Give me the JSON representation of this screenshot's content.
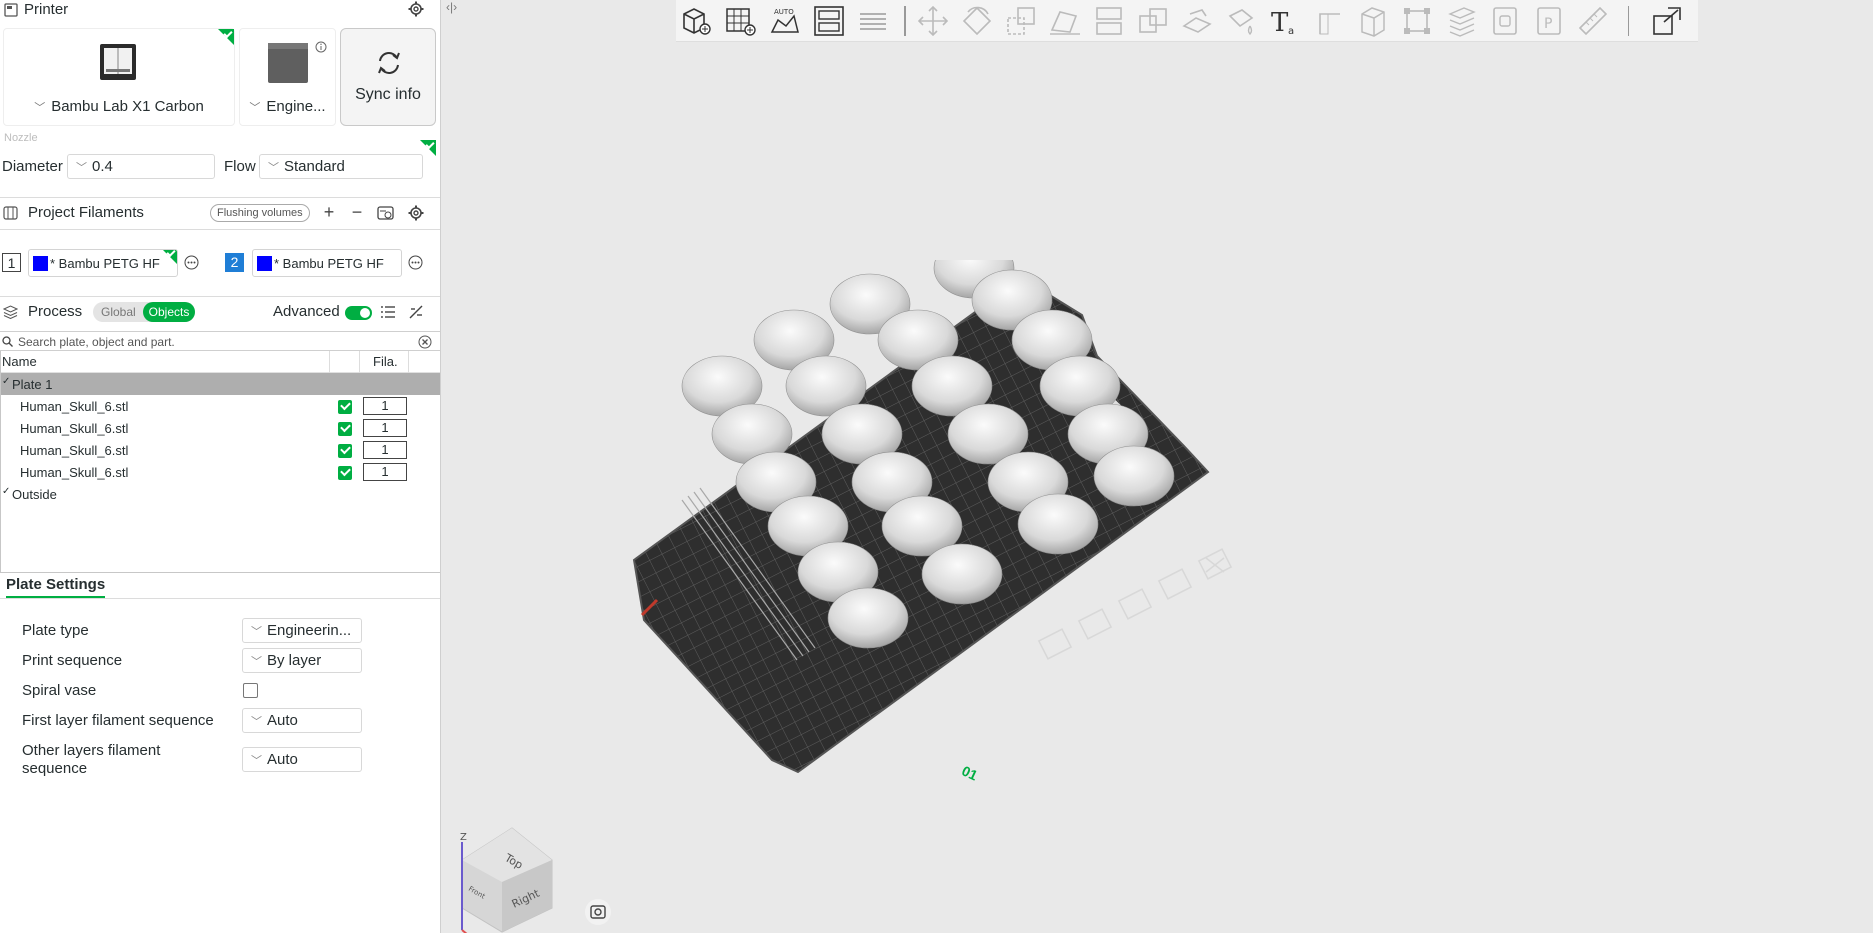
{
  "printer": {
    "section_title": "Printer",
    "printer_name": "Bambu Lab X1 Carbon",
    "plate_name": "Engine...",
    "sync_label": "Sync info",
    "nozzle_label": "Nozzle",
    "diameter_label": "Diameter",
    "diameter_value": "0.4",
    "flow_label": "Flow",
    "flow_value": "Standard"
  },
  "filaments": {
    "section_title": "Project Filaments",
    "flushing_label": "Flushing volumes",
    "items": [
      {
        "index": "1",
        "name": "* Bambu PETG HF",
        "color": "#0000ff"
      },
      {
        "index": "2",
        "name": "* Bambu PETG HF",
        "color": "#0000ff"
      }
    ]
  },
  "process": {
    "section_title": "Process",
    "global_label": "Global",
    "objects_label": "Objects",
    "advanced_label": "Advanced",
    "search_placeholder": "Search plate, object and part."
  },
  "tree": {
    "col_name": "Name",
    "col_fila": "Fila.",
    "plate_label": "Plate 1",
    "objects": [
      {
        "name": "Human_Skull_6.stl",
        "fila": "1"
      },
      {
        "name": "Human_Skull_6.stl",
        "fila": "1"
      },
      {
        "name": "Human_Skull_6.stl",
        "fila": "1"
      },
      {
        "name": "Human_Skull_6.stl",
        "fila": "1"
      }
    ],
    "outside_label": "Outside"
  },
  "plate_settings": {
    "tab_label": "Plate Settings",
    "plate_type_label": "Plate type",
    "plate_type_value": "Engineerin...",
    "print_sequence_label": "Print sequence",
    "print_sequence_value": "By layer",
    "spiral_vase_label": "Spiral vase",
    "first_layer_label": "First layer filament sequence",
    "first_layer_value": "Auto",
    "other_layers_label_1": "Other layers filament",
    "other_layers_label_2": "sequence",
    "other_layers_value": "Auto"
  },
  "viewport": {
    "plate_number": "01",
    "cube_top": "Top",
    "cube_right": "Right",
    "cube_front": "Front",
    "axis_z": "Z"
  },
  "colors": {
    "accent": "#00ae42",
    "filament": "#0000ff"
  }
}
